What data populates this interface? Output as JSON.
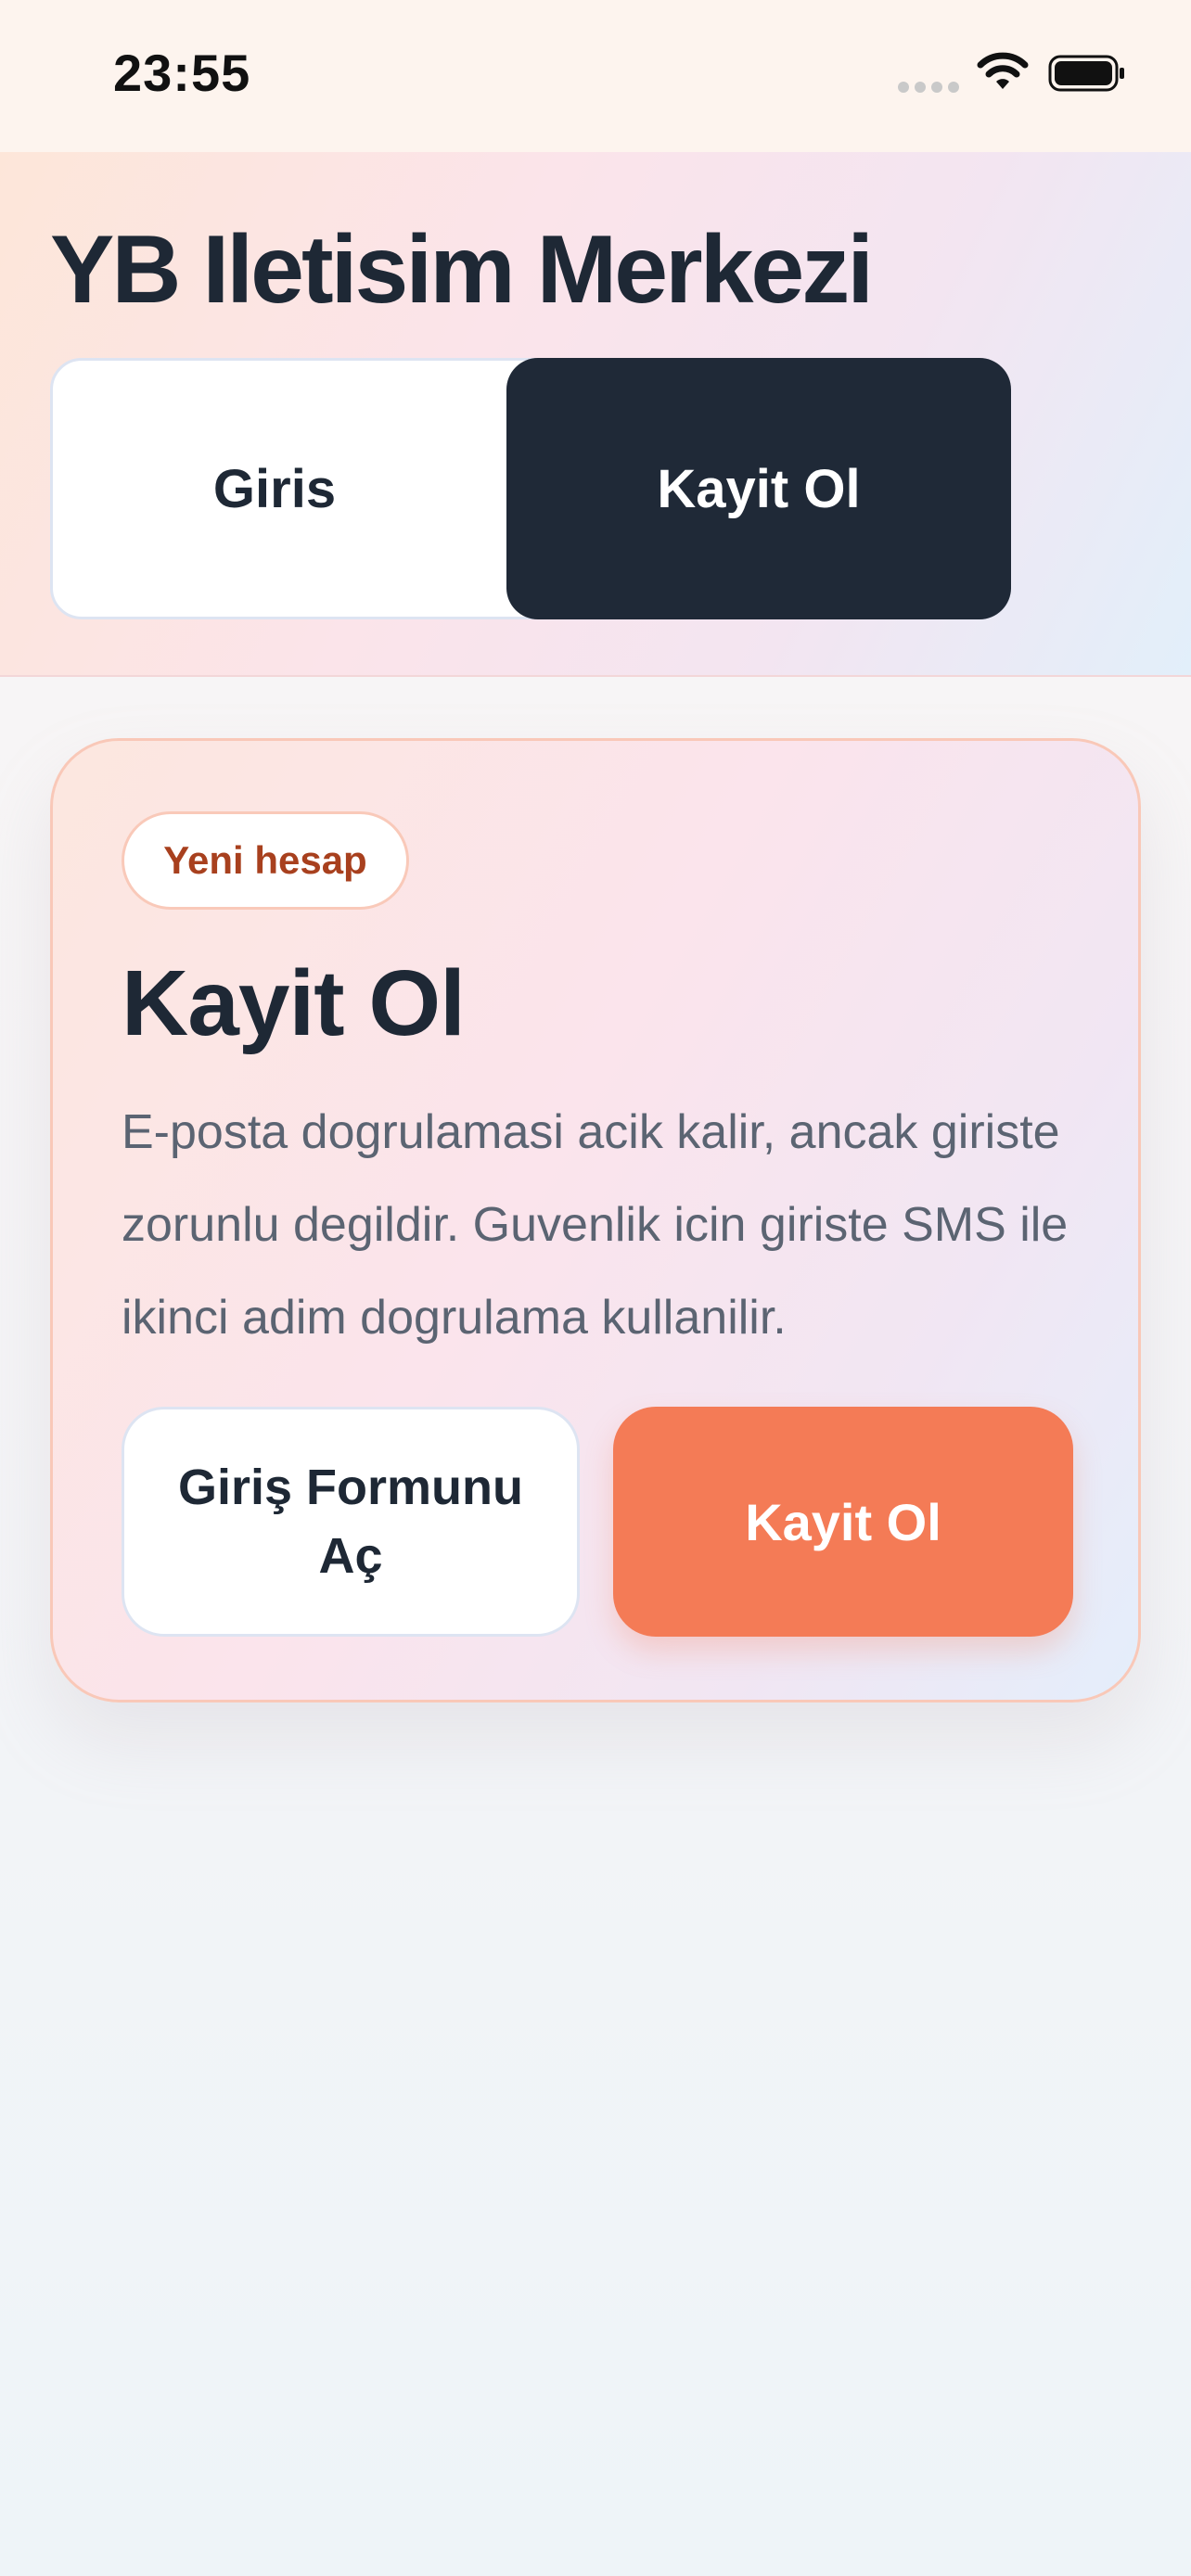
{
  "status_bar": {
    "time": "23:55"
  },
  "header": {
    "title": "YB Iletisim Merkezi",
    "tabs": [
      {
        "label": "Giris",
        "selected": false
      },
      {
        "label": "Kayit Ol",
        "selected": true
      }
    ]
  },
  "card": {
    "badge": "Yeni hesap",
    "title": "Kayit Ol",
    "description": "E-posta dogrulamasi acik kalir, ancak giriste zorunlu degildir. Guvenlik icin giriste SMS ile ikinci adim dogrulama kullanilir.",
    "secondary_button": "Giriş Formunu Aç",
    "primary_button": "Kayit Ol"
  },
  "colors": {
    "accent": "#f47b56",
    "dark": "#1f2937",
    "badge_text": "#a8401e"
  },
  "icons": [
    "signal-icon",
    "wifi-icon",
    "battery-icon"
  ]
}
